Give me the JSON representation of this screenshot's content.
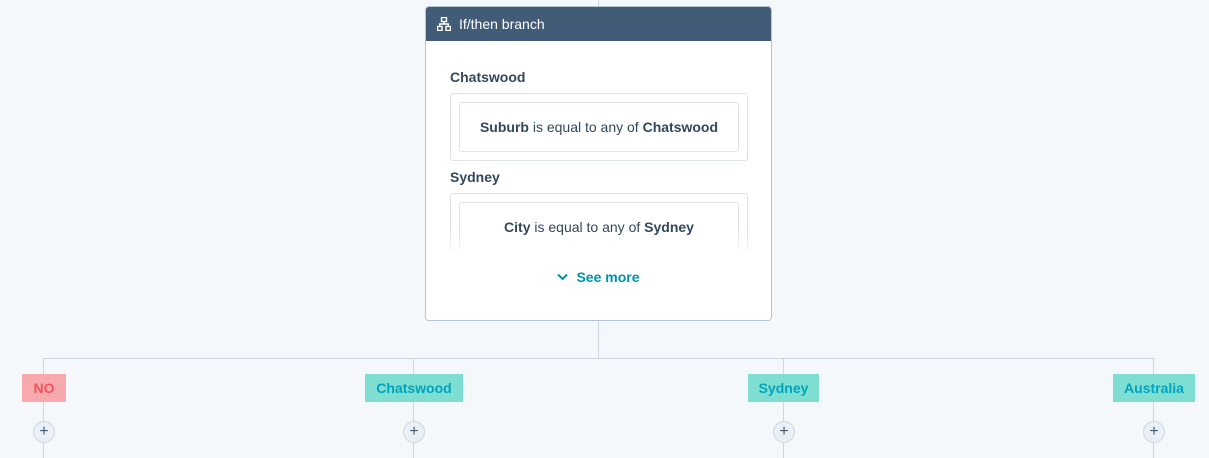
{
  "card": {
    "header_icon": "hierarchy-icon",
    "title": "If/then branch",
    "branches": [
      {
        "name": "Chatswood",
        "property": "Suburb",
        "operator": "is equal to any of",
        "value": "Chatswood"
      },
      {
        "name": "Sydney",
        "property": "City",
        "operator": "is equal to any of",
        "value": "Sydney"
      }
    ],
    "see_more_label": "See more"
  },
  "outcomes": [
    {
      "label": "NO"
    },
    {
      "label": "Chatswood"
    },
    {
      "label": "Sydney"
    },
    {
      "label": "Australia"
    }
  ],
  "add_action_symbol": "+",
  "colors": {
    "header_bg": "#425b76",
    "no_tag_bg": "#f8a9ad",
    "no_tag_text": "#f2545b",
    "branch_tag_bg": "#7fded2",
    "link": "#0091ae",
    "connector": "#cbd6e2"
  }
}
